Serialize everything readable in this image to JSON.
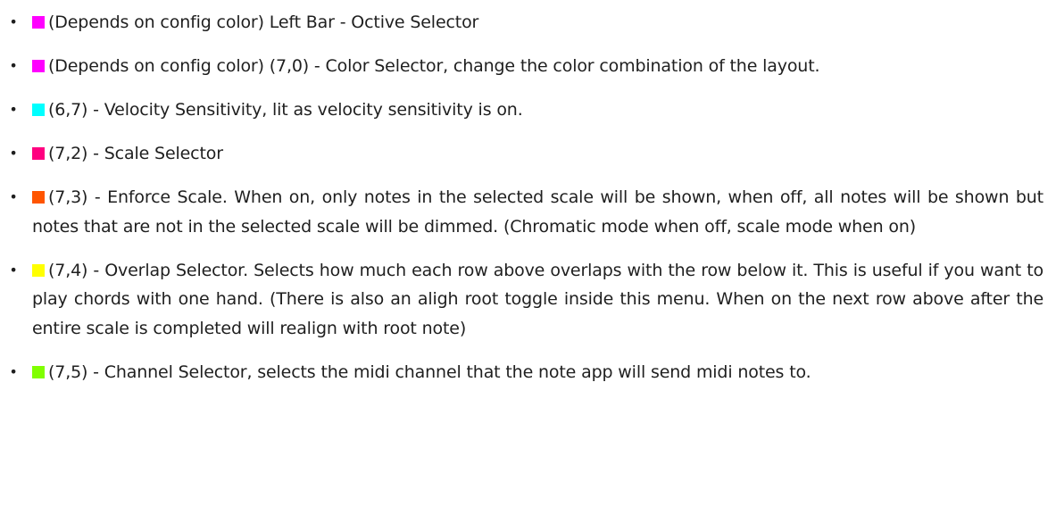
{
  "items": [
    {
      "color": "#ff00ff",
      "text": "(Depends on config color) Left Bar - Octive Selector"
    },
    {
      "color": "#ff00ff",
      "text": "(Depends on config color) (7,0) - Color Selector, change the color combination of the layout."
    },
    {
      "color": "#00ffff",
      "text": "(6,7) - Velocity Sensitivity, lit as velocity sensitivity is on."
    },
    {
      "color": "#ff0080",
      "text": "(7,2) - Scale Selector"
    },
    {
      "color": "#ff5500",
      "text": "(7,3) - Enforce Scale. When on, only notes in the selected scale will be shown, when off, all notes will be shown but notes that are not in the selected scale will be dimmed. (Chromatic mode when off, scale mode when on)"
    },
    {
      "color": "#ffff00",
      "text": "(7,4) - Overlap Selector. Selects how much each row above overlaps with the row below it. This is useful if you want to play chords with one hand. (There is also an aligh root toggle inside this menu. When on the next row above after the entire scale is completed will realign with root note)"
    },
    {
      "color": "#80ff00",
      "text": "(7,5) - Channel Selector, selects the midi channel that the note app will send midi notes to."
    }
  ]
}
